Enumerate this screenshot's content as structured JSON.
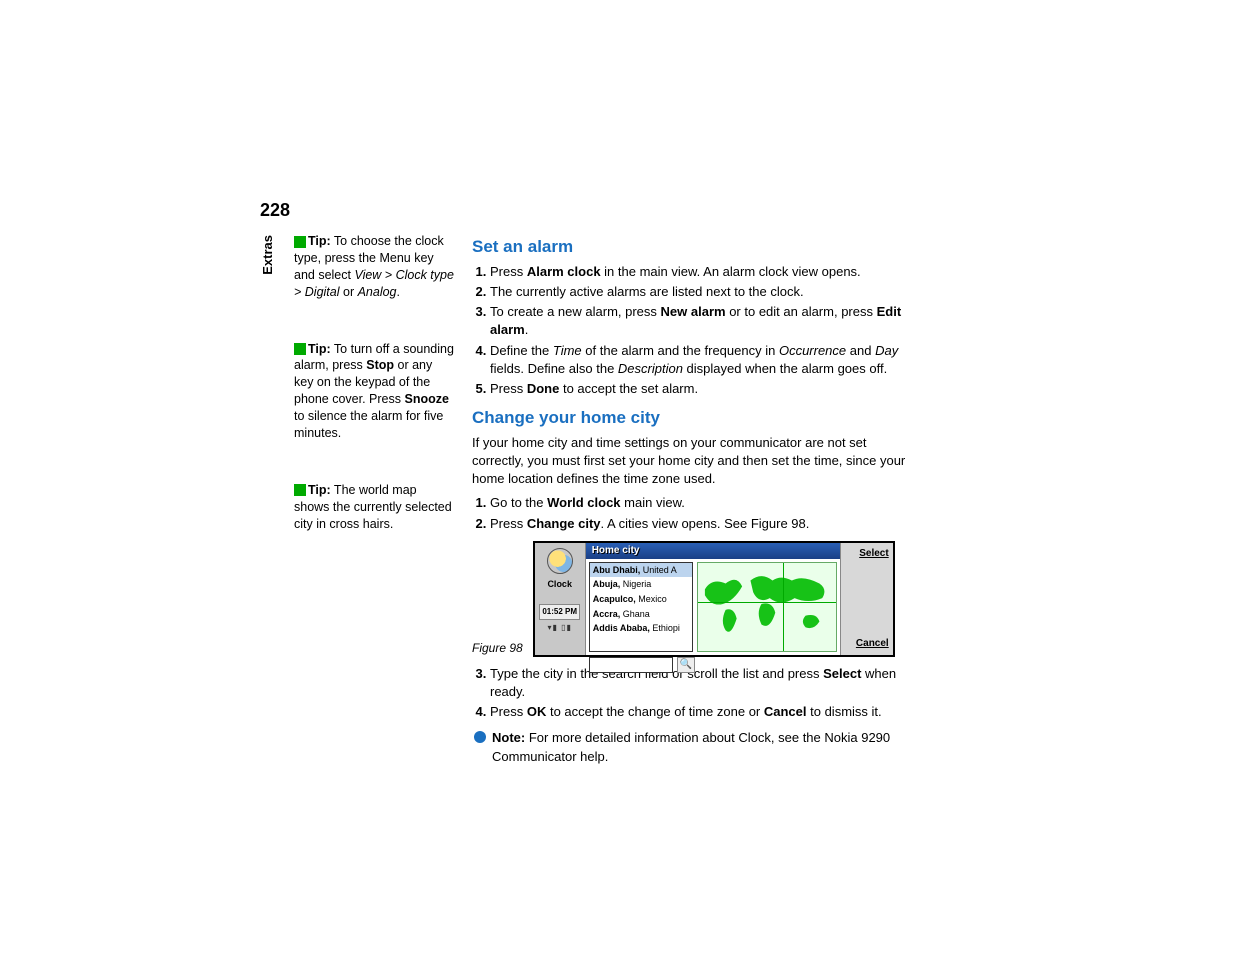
{
  "page_number": "228",
  "side_label": "Extras",
  "tips": {
    "tip1": {
      "label": "Tip:",
      "text_a": " To choose the clock type, press the Menu key and select ",
      "path": "View > Clock type > Digital",
      "text_b": " or ",
      "opt": "Analog",
      "text_c": "."
    },
    "tip2": {
      "label": "Tip:",
      "text_a": " To turn off a sounding alarm, press ",
      "b1": "Stop",
      "text_b": " or any key on the keypad of the phone cover. Press ",
      "b2": "Snooze",
      "text_c": " to silence the alarm for five minutes."
    },
    "tip3": {
      "label": "Tip:",
      "text": " The world map shows the currently selected city in cross hairs."
    }
  },
  "section1": {
    "heading": "Set an alarm",
    "steps": {
      "s1a": "Press ",
      "s1b": "Alarm clock",
      "s1c": " in the main view. An alarm clock view opens.",
      "s2": "The currently active alarms are listed next to the clock.",
      "s3a": "To create a new alarm, press ",
      "s3b": "New alarm",
      "s3c": " or to edit an alarm, press ",
      "s3d": "Edit alarm",
      "s3e": ".",
      "s4a": "Define the ",
      "s4b": "Time",
      "s4c": " of the alarm and the frequency in ",
      "s4d": "Occurrence",
      "s4e": " and ",
      "s4f": "Day",
      "s4g": " fields. Define also the ",
      "s4h": "Description",
      "s4i": " displayed when the alarm goes off.",
      "s5a": "Press ",
      "s5b": "Done",
      "s5c": " to accept the set alarm."
    }
  },
  "section2": {
    "heading": "Change your home city",
    "intro": "If your home city and time settings on your communicator are not set correctly, you must first set your home city and then set the time, since your home location defines the time zone used.",
    "steps12": {
      "s1a": "Go to the ",
      "s1b": "World clock",
      "s1c": " main view.",
      "s2a": "Press ",
      "s2b": "Change city",
      "s2c": ". A cities view opens. See Figure 98."
    },
    "fig_label": "Figure 98",
    "fig": {
      "titlebar": "Home city",
      "left_label": "Clock",
      "time": "01:52 PM",
      "list": [
        {
          "city": "Abu Dhabi,",
          "country": " United A"
        },
        {
          "city": "Abuja,",
          "country": " Nigeria"
        },
        {
          "city": "Acapulco,",
          "country": " Mexico"
        },
        {
          "city": "Accra,",
          "country": " Ghana"
        },
        {
          "city": "Addis Ababa,",
          "country": " Ethiopi"
        }
      ],
      "btn_select": "Select",
      "btn_cancel": "Cancel"
    },
    "steps34": {
      "s3a": "Type the city in the search field or scroll the list and press ",
      "s3b": "Select",
      "s3c": " when ready.",
      "s4a": "Press ",
      "s4b": "OK",
      "s4c": " to accept the change of time zone or ",
      "s4d": "Cancel",
      "s4e": " to dismiss it."
    },
    "note": {
      "label": "Note:",
      "text": " For more detailed information about Clock, see the Nokia 9290 Communicator help."
    }
  }
}
